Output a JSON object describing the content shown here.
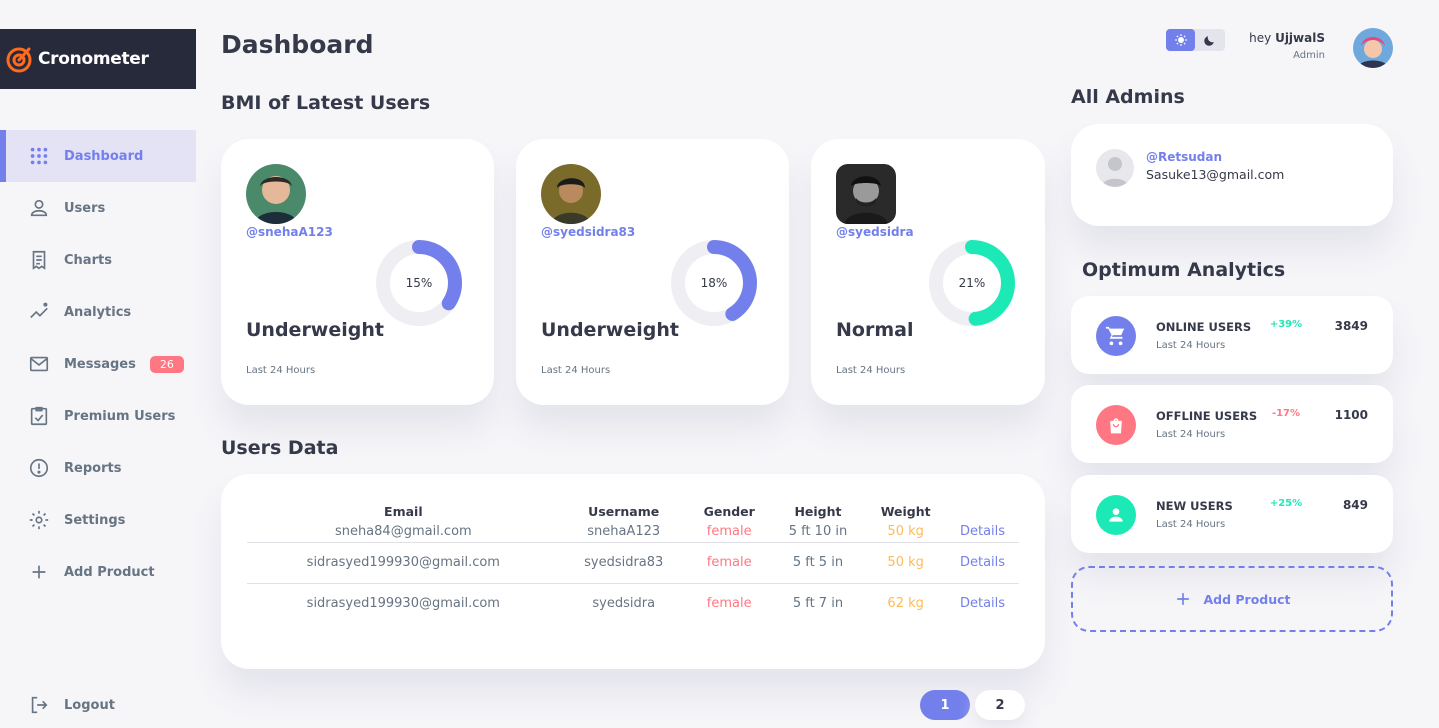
{
  "brand": {
    "name": "Cronometer"
  },
  "sidebar": {
    "items": [
      {
        "label": "Dashboard",
        "icon": "grid-icon",
        "active": true
      },
      {
        "label": "Users",
        "icon": "person-icon"
      },
      {
        "label": "Charts",
        "icon": "receipt-icon"
      },
      {
        "label": "Analytics",
        "icon": "insights-icon"
      },
      {
        "label": "Messages",
        "icon": "mail-icon",
        "badge": "26"
      },
      {
        "label": "Premium Users",
        "icon": "inventory-icon"
      },
      {
        "label": "Reports",
        "icon": "report-icon"
      },
      {
        "label": "Settings",
        "icon": "gear-icon"
      },
      {
        "label": "Add Product",
        "icon": "plus-icon"
      }
    ],
    "logout": "Logout"
  },
  "header": {
    "title": "Dashboard"
  },
  "bmi": {
    "title": "BMI of Latest Users",
    "cards": [
      {
        "username": "@snehaA123",
        "percent": "15%",
        "percent_value": 0.15,
        "status": "Underweight",
        "period": "Last 24 Hours",
        "color": "#7380ec"
      },
      {
        "username": "@syedsidra83",
        "percent": "18%",
        "percent_value": 0.18,
        "status": "Underweight",
        "period": "Last 24 Hours",
        "color": "#7380ec"
      },
      {
        "username": "@syedsidra",
        "percent": "21%",
        "percent_value": 0.21,
        "status": "Normal",
        "period": "Last 24 Hours",
        "color": "#1de9b6"
      }
    ]
  },
  "users_table": {
    "title": "Users Data",
    "columns": [
      "Email",
      "Username",
      "Gender",
      "Height",
      "Weight",
      ""
    ],
    "rows": [
      {
        "email": "sneha84@gmail.com",
        "username": "snehaA123",
        "gender": "female",
        "height": "5 ft 10 in",
        "weight": "50 kg",
        "action": "Details"
      },
      {
        "email": "sidrasyed199930@gmail.com",
        "username": "syedsidra83",
        "gender": "female",
        "height": "5 ft 5 in",
        "weight": "50 kg",
        "action": "Details"
      },
      {
        "email": "sidrasyed199930@gmail.com",
        "username": "syedsidra",
        "gender": "female",
        "height": "5 ft 7 in",
        "weight": "62 kg",
        "action": "Details"
      }
    ]
  },
  "pagination": {
    "pages": [
      "1",
      "2"
    ],
    "current": "1"
  },
  "profile": {
    "greeting": "hey",
    "name": "UjjwalS",
    "role": "Admin"
  },
  "admins": {
    "title": "All Admins",
    "items": [
      {
        "handle": "@Retsudan",
        "email": "Sasuke13@gmail.com"
      }
    ]
  },
  "analytics": {
    "title": "Optimum Analytics",
    "items": [
      {
        "title": "ONLINE USERS",
        "sub": "Last 24 Hours",
        "change": "+39%",
        "value": "3849",
        "icon": "cart-icon",
        "color": "#7380ec",
        "change_color": "#1de9b6"
      },
      {
        "title": "OFFLINE USERS",
        "sub": "Last 24 Hours",
        "change": "-17%",
        "value": "1100",
        "icon": "shopping-bag-icon",
        "color": "#ff7782",
        "change_color": "#ff7782"
      },
      {
        "title": "NEW USERS",
        "sub": "Last 24 Hours",
        "change": "+25%",
        "value": "849",
        "icon": "person-icon",
        "color": "#1de9b6",
        "change_color": "#1de9b6"
      }
    ],
    "add_product": "Add Product"
  },
  "colors": {
    "primary": "#7380ec",
    "danger": "#ff7782",
    "success": "#1de9b6",
    "warning": "#ffbb55",
    "dark": "#363949"
  }
}
